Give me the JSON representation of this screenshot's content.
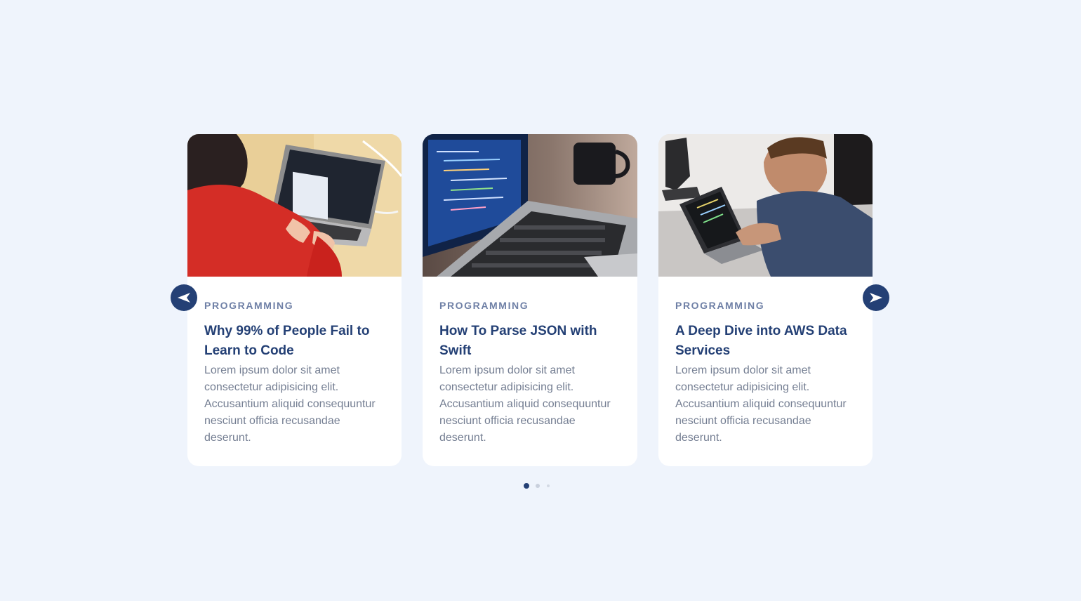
{
  "carousel": {
    "prev_icon": "arrow-left-icon",
    "next_icon": "arrow-right-icon",
    "cards": [
      {
        "category": "PROGRAMMING",
        "title": "Why 99% of People Fail to Learn to Code",
        "text": "Lorem ipsum dolor sit amet consectetur adipisicing elit. Accusantium aliquid consequuntur nesciunt officia recusandae deserunt."
      },
      {
        "category": "PROGRAMMING",
        "title": "How To Parse JSON with Swift",
        "text": "Lorem ipsum dolor sit amet consectetur adipisicing elit. Accusantium aliquid consequuntur nesciunt officia recusandae deserunt."
      },
      {
        "category": "PROGRAMMING",
        "title": "A Deep Dive into AWS Data Services",
        "text": "Lorem ipsum dolor sit amet consectetur adipisicing elit. Accusantium aliquid consequuntur nesciunt officia recusandae deserunt."
      }
    ],
    "pagination": {
      "active_index": 0,
      "count": 3
    }
  },
  "colors": {
    "background": "#eff4fc",
    "accent": "#244075",
    "category": "#6f80a6",
    "body_text": "#747e92"
  }
}
